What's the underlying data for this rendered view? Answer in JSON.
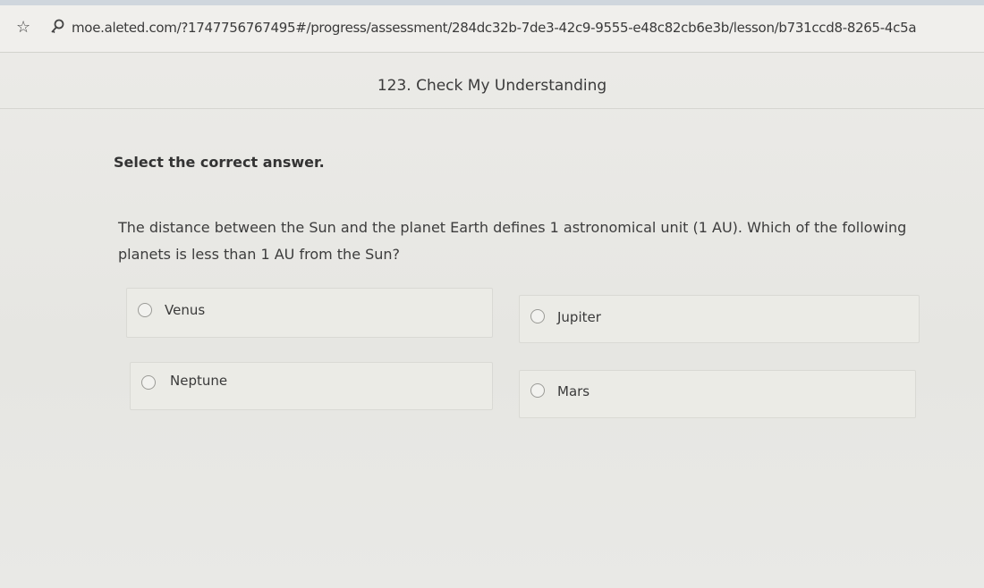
{
  "browser": {
    "url": "moe.aleted.com/?1747756767495#/progress/assessment/284dc32b-7de3-42c9-9555-e48c82cb6e3b/lesson/b731ccd8-8265-4c5a"
  },
  "lesson": {
    "title": "123. Check My Understanding"
  },
  "question": {
    "instruction": "Select the correct answer.",
    "text": "The distance between the Sun and the planet Earth defines 1 astronomical unit (1 AU). Which of the following planets is less than 1 AU from the Sun?",
    "choices": [
      {
        "label": "Venus"
      },
      {
        "label": "Jupiter"
      },
      {
        "label": "Neptune"
      },
      {
        "label": "Mars"
      }
    ]
  }
}
